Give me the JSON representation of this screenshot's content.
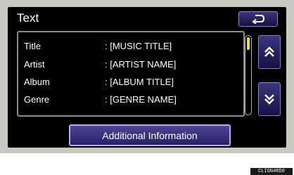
{
  "screen": {
    "title": "Text"
  },
  "list": {
    "rows": [
      {
        "label": "Title",
        "value": ": [MUSIC TITLE]"
      },
      {
        "label": "Artist",
        "value": ": [ARTIST NAME]"
      },
      {
        "label": "Album",
        "value": ": [ALBUM TITLE]"
      },
      {
        "label": "Genre",
        "value": ": [GENRE NAME]"
      }
    ]
  },
  "buttons": {
    "back_icon": "back-arrow-icon",
    "page_up_icon": "double-chevron-up-icon",
    "page_down_icon": "double-chevron-down-icon",
    "additional_info_label": "Additional Information"
  },
  "watermark": "CLIGN4RD0",
  "colors": {
    "screen_bg": "#000000",
    "button_border": "#8a84c8",
    "scroll_thumb": "#e8e020",
    "text": "#ffffff"
  }
}
